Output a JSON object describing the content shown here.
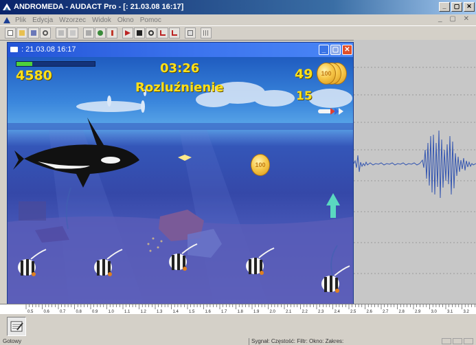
{
  "window": {
    "title": "ANDROMEDA - AUDACT Pro - [: 21.03.08 16:17]",
    "controls": {
      "minimize": "_",
      "maximize": "▢",
      "close": "✕"
    }
  },
  "menu": {
    "items": [
      "Plik",
      "Edycja",
      "Wzorzec",
      "Widok",
      "Okno",
      "Pomoc"
    ],
    "right_controls": "_ ▢ ✕"
  },
  "toolbar": {
    "buttons": [
      "new-file-icon",
      "open-folder-icon",
      "save-icon",
      "search-icon",
      "copy-icon",
      "paste-icon",
      "cut-icon",
      "marker-icon",
      "trend-icon",
      "forward-icon",
      "back-icon",
      "zoom-icon",
      "chart-up-icon",
      "chart-down-icon",
      "table-icon",
      "grid-icon"
    ]
  },
  "game_window": {
    "title": ": 21.03.08 16:17",
    "controls": {
      "minimize": "_",
      "maximize": "▢",
      "close": "✕"
    }
  },
  "hud": {
    "score": "4580",
    "timer": "03:26",
    "mode": "Rozluźnienie",
    "coins": "49",
    "arrows": "15",
    "energy_fraction": 0.2
  },
  "coin_labels": {
    "hud_coin": "100",
    "floating_coin": "100"
  },
  "ruler": {
    "labels": [
      "0.5",
      "0.6",
      "0.7",
      "0.8",
      "0.9",
      "1.0",
      "1.1",
      "1.2",
      "1.3",
      "1.4",
      "1.5",
      "1.6",
      "1.7",
      "1.8",
      "1.9",
      "2.0",
      "2.1",
      "2.2",
      "2.3",
      "2.4",
      "2.5",
      "2.6",
      "2.7",
      "2.8",
      "2.9",
      "3.0",
      "3.1",
      "3.2"
    ]
  },
  "statusbar": {
    "left": "Gotowy",
    "middle": "Sygnał: Częstość: Filtr: Okno: Zakres:"
  },
  "colors": {
    "hud_text": "#ffe01a",
    "energy_fill": "#4ed23c",
    "waveform": "#3355b0"
  }
}
